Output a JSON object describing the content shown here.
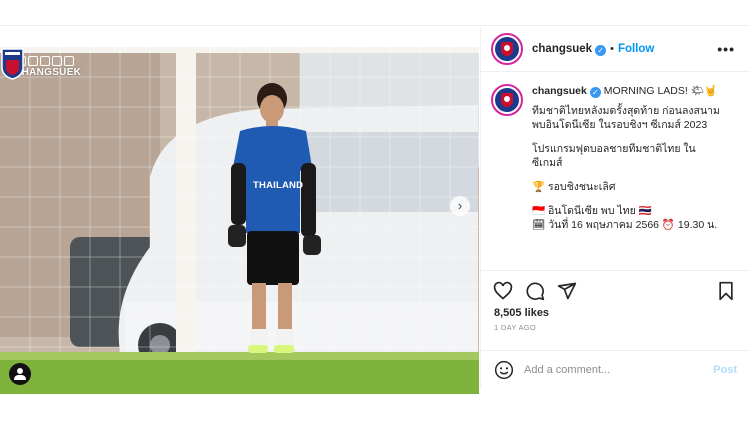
{
  "media": {
    "brand_handle": "@CHANGSUEK",
    "jersey_text": "THAILAND",
    "crest_text": "THAILAND"
  },
  "post": {
    "username": "changsuek",
    "verified_mark": "✓",
    "separator": "•",
    "follow_label": "Follow",
    "more_label": "•••",
    "caption_headline": "MORNING LADS! 🌤🤘",
    "caption_lines": [
      "ทีมชาติไทยหลังมดรั้งสุดท้าย ก่อนลงสนาม",
      "พบอินโดนีเซีย ในรอบชิงฯ ซีเกมส์ 2023",
      "โปรแกรมฟุตบอลชายทีมชาติไทย ใน",
      "ซีเกมส์",
      "🏆 รอบชิงชนะเลิศ",
      "🇮🇩 อินโดนีเซีย พบ ไทย 🇹🇭",
      "🗓 วันที่ 16 พฤษภาคม 2566 ⏰ 19.30 น."
    ],
    "likes": "8,505 likes",
    "date": "1 DAY AGO",
    "comment_placeholder": "Add a comment...",
    "post_label": "Post",
    "next_label": "›"
  },
  "colors": {
    "link_blue": "#0095f6",
    "post_disabled": "#b2dffc",
    "verified_blue": "#3897f0",
    "story_ring": "#d6249f"
  },
  "icons": [
    "heart-icon",
    "comment-icon",
    "share-icon",
    "bookmark-icon",
    "emoji-icon",
    "tag-user-icon",
    "chevron-right-icon",
    "more-icon"
  ]
}
